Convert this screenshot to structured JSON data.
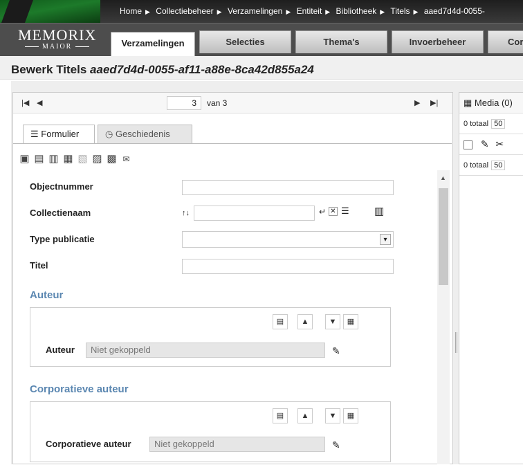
{
  "topbar": {
    "crumbs": [
      "Home",
      "Collectiebeheer",
      "Verzamelingen",
      "Entiteit",
      "Bibliotheek",
      "Titels",
      "aaed7d4d-0055-"
    ]
  },
  "logo": {
    "line1": "MEMORIX",
    "line2": "MAIOR"
  },
  "nav": {
    "tabs": [
      {
        "label": "Verzamelingen",
        "active": true
      },
      {
        "label": "Selecties"
      },
      {
        "label": "Thema's"
      },
      {
        "label": "Invoerbeheer"
      },
      {
        "label": "Cor"
      }
    ]
  },
  "page": {
    "title_prefix": "Bewerk Titels ",
    "title_id": "aaed7d4d-0055-af11-a88e-8ca42d855a24"
  },
  "pager": {
    "first": "⏮",
    "prev": "◀",
    "current": "3",
    "of": "van 3",
    "next": "▶",
    "last": "⏭"
  },
  "formtabs": [
    {
      "icon": "form-icon",
      "label": "Formulier"
    },
    {
      "icon": "history-icon",
      "label": "Geschiedenis"
    }
  ],
  "toolbar": {
    "icons": [
      "save-icon",
      "new-record-icon",
      "copy-icon",
      "delete-icon",
      "paste-icon",
      "notes-icon",
      "print-icon",
      "email-icon"
    ]
  },
  "form": {
    "objectnummer_label": "Objectnummer",
    "objectnummer_value": "",
    "collectienaam_label": "Collectienaam",
    "collectienaam_value": "",
    "type_label": "Type publicatie",
    "type_value": "",
    "titel_label": "Titel",
    "titel_value": ""
  },
  "auteur": {
    "section": "Auteur",
    "field_label": "Auteur",
    "value": "Niet gekoppeld"
  },
  "corporatieve": {
    "section": "Corporatieve auteur",
    "field_label": "Corporatieve auteur",
    "value": "Niet gekoppeld"
  },
  "media": {
    "title": "Media (0)",
    "row1_text": "0 totaal",
    "row1_num": "50",
    "row3_text": "0 totaal",
    "row3_num": "50"
  }
}
